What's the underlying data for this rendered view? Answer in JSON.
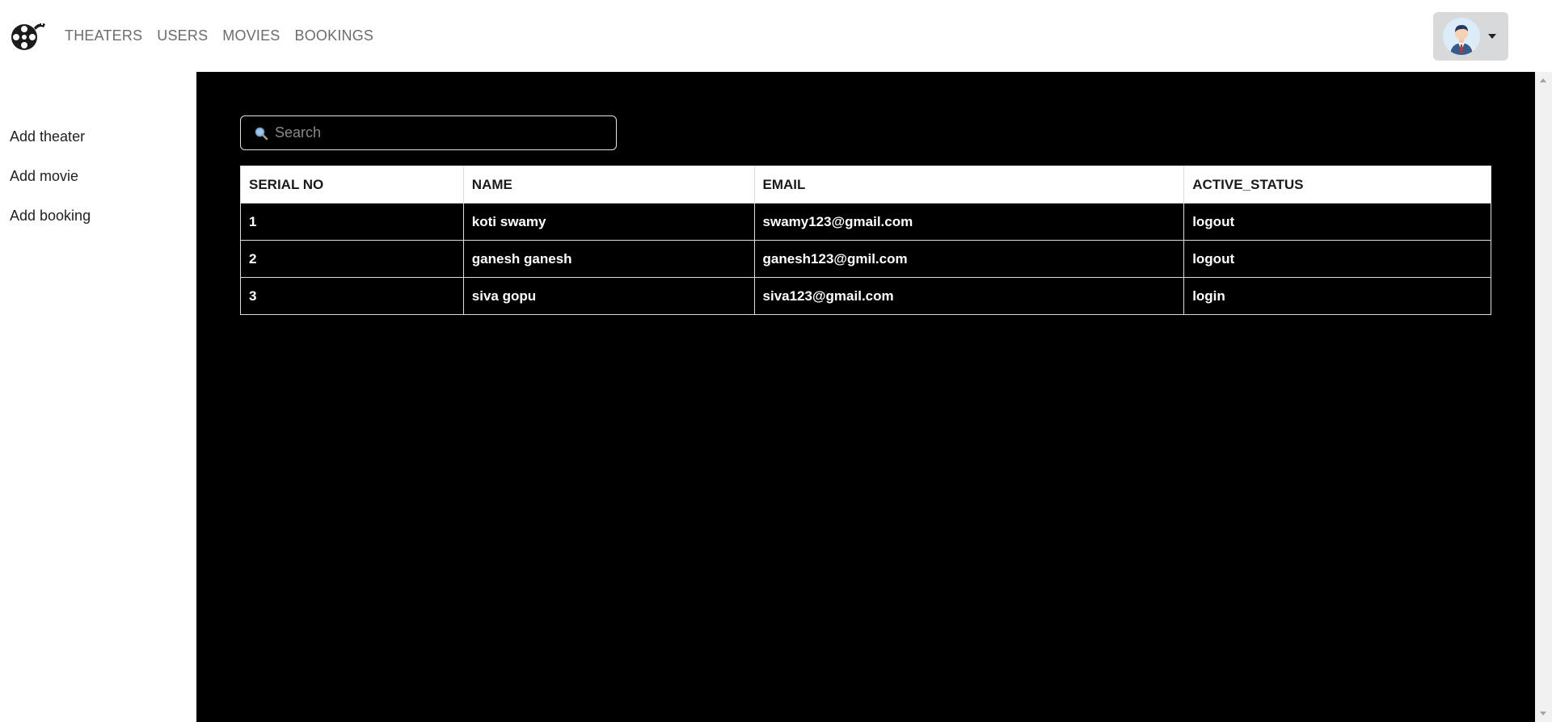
{
  "nav": {
    "logo_icon": "film-reel-icon",
    "links": [
      "THEATERS",
      "USERS",
      "MOVIES",
      "BOOKINGS"
    ],
    "profile_icon": "user-avatar-icon"
  },
  "sidebar": {
    "items": [
      {
        "label": "Add theater"
      },
      {
        "label": "Add movie"
      },
      {
        "label": "Add booking"
      }
    ]
  },
  "search": {
    "placeholder": "Search",
    "icon": "search-icon"
  },
  "table": {
    "headers": [
      "SERIAL NO",
      "NAME",
      "EMAIL",
      "ACTIVE_STATUS"
    ],
    "rows": [
      {
        "serial": "1",
        "name": "koti swamy",
        "email": "swamy123@gmail.com",
        "status": "logout"
      },
      {
        "serial": "2",
        "name": "ganesh ganesh",
        "email": "ganesh123@gmil.com",
        "status": "logout"
      },
      {
        "serial": "3",
        "name": "siva gopu",
        "email": "siva123@gmail.com",
        "status": "login"
      }
    ]
  },
  "colors": {
    "main_bg": "#000000",
    "nav_text": "#6c6c6c",
    "profile_btn_bg": "#d7d9db"
  }
}
